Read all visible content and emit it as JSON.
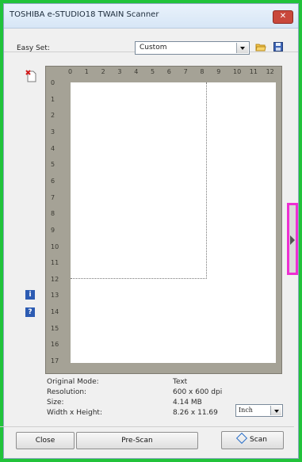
{
  "window": {
    "title": "TOSHIBA e-STUDIO18 TWAIN Scanner",
    "close_glyph": "✕"
  },
  "easy_set": {
    "label": "Easy Set:",
    "selected": "Custom"
  },
  "icons": {
    "folder": "folder-icon",
    "save": "save-icon",
    "clear_preview": "clear-preview-icon",
    "info": "info-icon",
    "help": "help-icon"
  },
  "side_glyphs": {
    "info": "i",
    "help": "?"
  },
  "ruler": {
    "horizontal": [
      "0",
      "1",
      "2",
      "3",
      "4",
      "5",
      "6",
      "7",
      "8",
      "9",
      "10",
      "11",
      "12"
    ],
    "vertical": [
      "0",
      "1",
      "2",
      "3",
      "4",
      "5",
      "6",
      "7",
      "8",
      "9",
      "10",
      "11",
      "12",
      "13",
      "14",
      "15",
      "16",
      "17"
    ]
  },
  "info_panel": {
    "original_mode_label": "Original Mode:",
    "original_mode_value": "Text",
    "resolution_label": "Resolution:",
    "resolution_value": "600 x 600 dpi",
    "size_label": "Size:",
    "size_value": "4.14 MB",
    "wh_label": "Width x Height:",
    "wh_value": "8.26 x 11.69"
  },
  "unit": {
    "selected": "Inch"
  },
  "buttons": {
    "close": "Close",
    "pre_scan": "Pre-Scan",
    "scan": "Scan"
  },
  "colors": {
    "background": "#21c33a",
    "highlight": "#ee2fd2"
  }
}
